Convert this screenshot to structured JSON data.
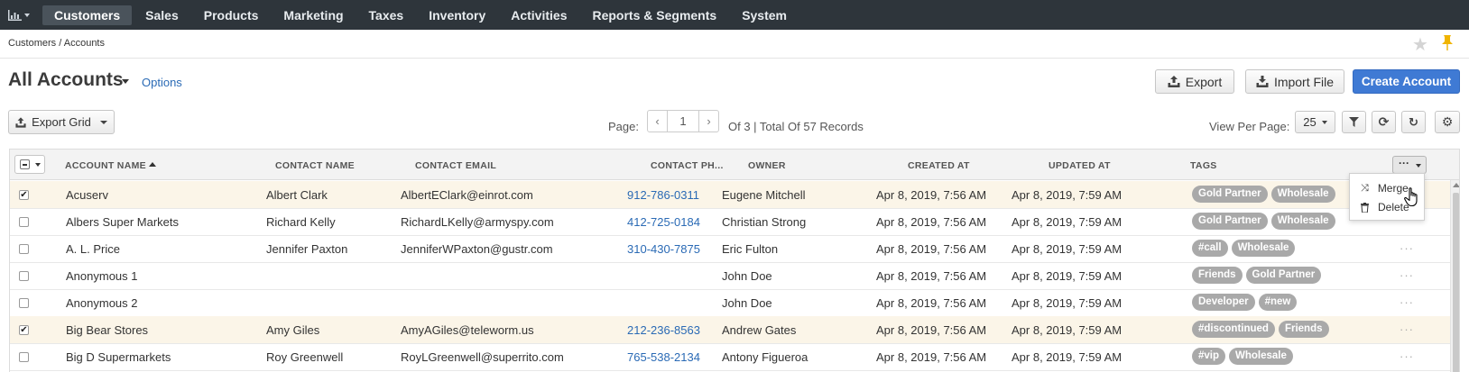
{
  "nav": {
    "items": [
      "Customers",
      "Sales",
      "Products",
      "Marketing",
      "Taxes",
      "Inventory",
      "Activities",
      "Reports & Segments",
      "System"
    ],
    "active": "Customers"
  },
  "breadcrumb": "Customers / Accounts",
  "page": {
    "title": "All Accounts",
    "options_label": "Options",
    "export_label": "Export",
    "import_label": "Import File",
    "create_label": "Create Account",
    "export_grid_label": "Export Grid"
  },
  "pager": {
    "label": "Page:",
    "current": "1",
    "info": "Of 3 | Total Of 57 Records",
    "view_per_page_label": "View Per Page:",
    "per_page": "25"
  },
  "grid": {
    "headers": [
      "ACCOUNT NAME",
      "CONTACT NAME",
      "CONTACT EMAIL",
      "CONTACT PH...",
      "OWNER",
      "CREATED AT",
      "UPDATED AT",
      "TAGS"
    ],
    "rows": [
      {
        "checked": true,
        "name": "Acuserv",
        "contact": "Albert Clark",
        "email": "AlbertEClark@einrot.com",
        "phone": "912-786-0311",
        "owner": "Eugene Mitchell",
        "created": "Apr 8, 2019, 7:56 AM",
        "updated": "Apr 8, 2019, 7:59 AM",
        "tags": [
          "Gold Partner",
          "Wholesale"
        ]
      },
      {
        "checked": false,
        "name": "Albers Super Markets",
        "contact": "Richard Kelly",
        "email": "RichardLKelly@armyspy.com",
        "phone": "412-725-0184",
        "owner": "Christian Strong",
        "created": "Apr 8, 2019, 7:56 AM",
        "updated": "Apr 8, 2019, 7:59 AM",
        "tags": [
          "Gold Partner",
          "Wholesale"
        ]
      },
      {
        "checked": false,
        "name": "A. L. Price",
        "contact": "Jennifer Paxton",
        "email": "JenniferWPaxton@gustr.com",
        "phone": "310-430-7875",
        "owner": "Eric Fulton",
        "created": "Apr 8, 2019, 7:56 AM",
        "updated": "Apr 8, 2019, 7:59 AM",
        "tags": [
          "#call",
          "Wholesale"
        ]
      },
      {
        "checked": false,
        "name": "Anonymous 1",
        "contact": "",
        "email": "",
        "phone": "",
        "owner": "John Doe",
        "created": "Apr 8, 2019, 7:56 AM",
        "updated": "Apr 8, 2019, 7:59 AM",
        "tags": [
          "Friends",
          "Gold Partner"
        ]
      },
      {
        "checked": false,
        "name": "Anonymous 2",
        "contact": "",
        "email": "",
        "phone": "",
        "owner": "John Doe",
        "created": "Apr 8, 2019, 7:56 AM",
        "updated": "Apr 8, 2019, 7:59 AM",
        "tags": [
          "Developer",
          "#new"
        ]
      },
      {
        "checked": true,
        "name": "Big Bear Stores",
        "contact": "Amy Giles",
        "email": "AmyAGiles@teleworm.us",
        "phone": "212-236-8563",
        "owner": "Andrew Gates",
        "created": "Apr 8, 2019, 7:56 AM",
        "updated": "Apr 8, 2019, 7:59 AM",
        "tags": [
          "#discontinued",
          "Friends"
        ]
      },
      {
        "checked": false,
        "name": "Big D Supermarkets",
        "contact": "Roy Greenwell",
        "email": "RoyLGreenwell@superrito.com",
        "phone": "765-538-2134",
        "owner": "Antony Figueroa",
        "created": "Apr 8, 2019, 7:56 AM",
        "updated": "Apr 8, 2019, 7:59 AM",
        "tags": [
          "#vip",
          "Wholesale"
        ]
      }
    ]
  },
  "menu": {
    "merge_label": "Merge",
    "delete_label": "Delete"
  },
  "colors": {
    "nav_bg": "#2e353b",
    "primary": "#3f7ad4",
    "link": "#2a6ab5",
    "tag_bg": "#a9a9a9",
    "selected_row": "#fbf5e8",
    "pin": "#f0b400"
  }
}
